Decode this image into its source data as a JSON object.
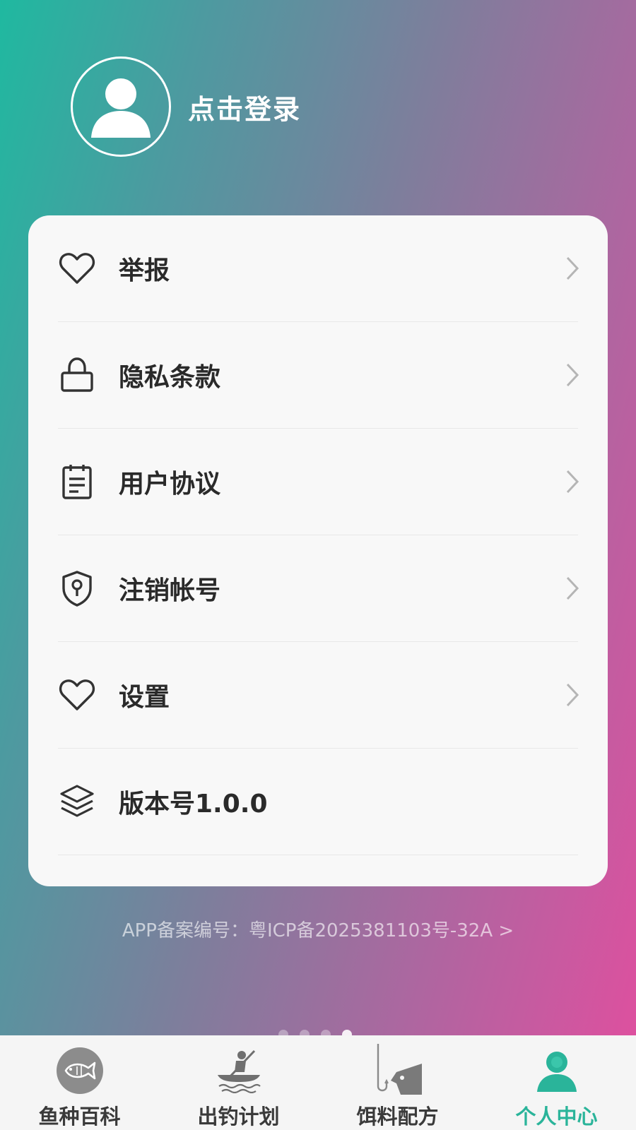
{
  "profile": {
    "login_label": "点击登录"
  },
  "menu": {
    "items": [
      {
        "label": "举报",
        "icon": "heart-icon"
      },
      {
        "label": "隐私条款",
        "icon": "lock-icon"
      },
      {
        "label": "用户协议",
        "icon": "clipboard-icon"
      },
      {
        "label": "注销帐号",
        "icon": "shield-keyhole-icon"
      },
      {
        "label": "设置",
        "icon": "heart-icon"
      },
      {
        "label": "版本号1.0.0",
        "icon": "layers-icon"
      }
    ]
  },
  "footer": {
    "icp_text": "APP备案编号：粤ICP备2025381103号-32A >"
  },
  "tabbar": {
    "active_index": 3,
    "active_color": "#2ab49a",
    "tabs": [
      {
        "label": "鱼种百科",
        "icon": "fish-icon"
      },
      {
        "label": "出钓计划",
        "icon": "kayak-icon"
      },
      {
        "label": "饵料配方",
        "icon": "hook-bait-icon"
      },
      {
        "label": "个人中心",
        "icon": "user-icon"
      }
    ]
  }
}
